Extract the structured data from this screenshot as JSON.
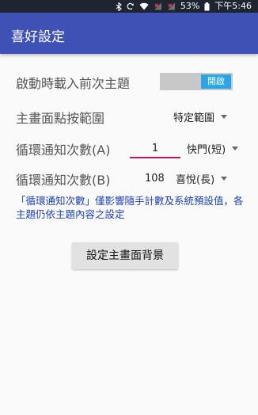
{
  "status_bar": {
    "battery": "53%",
    "time": "下午5:46"
  },
  "app_bar": {
    "title": "喜好設定"
  },
  "settings": {
    "load_last_theme": {
      "label": "啟動時載入前次主題",
      "toggle_text": "開啟"
    },
    "tap_range": {
      "label": "主畫面點按範圍",
      "value": "特定範圍"
    },
    "cycle_a": {
      "label": "循環通知次數(A)",
      "count": "1",
      "mode": "快門(短)"
    },
    "cycle_b": {
      "label": "循環通知次數(B)",
      "count": "108",
      "mode": "喜悅(長)"
    },
    "note": "「循環通知次數」僅影響隨手計數及系統預設值，各主題仍依主題內容之設定"
  },
  "background_button": {
    "label": "設定主畫面背景"
  },
  "colors": {
    "app_bar": "#3f51b5",
    "toggle_on": "#2aa6e6",
    "note_text": "#1a3fb5",
    "underline_accent": "#c2185b"
  },
  "icons": [
    "bluetooth-icon",
    "sync-icon",
    "wifi-icon",
    "signal-icon",
    "battery-icon"
  ]
}
